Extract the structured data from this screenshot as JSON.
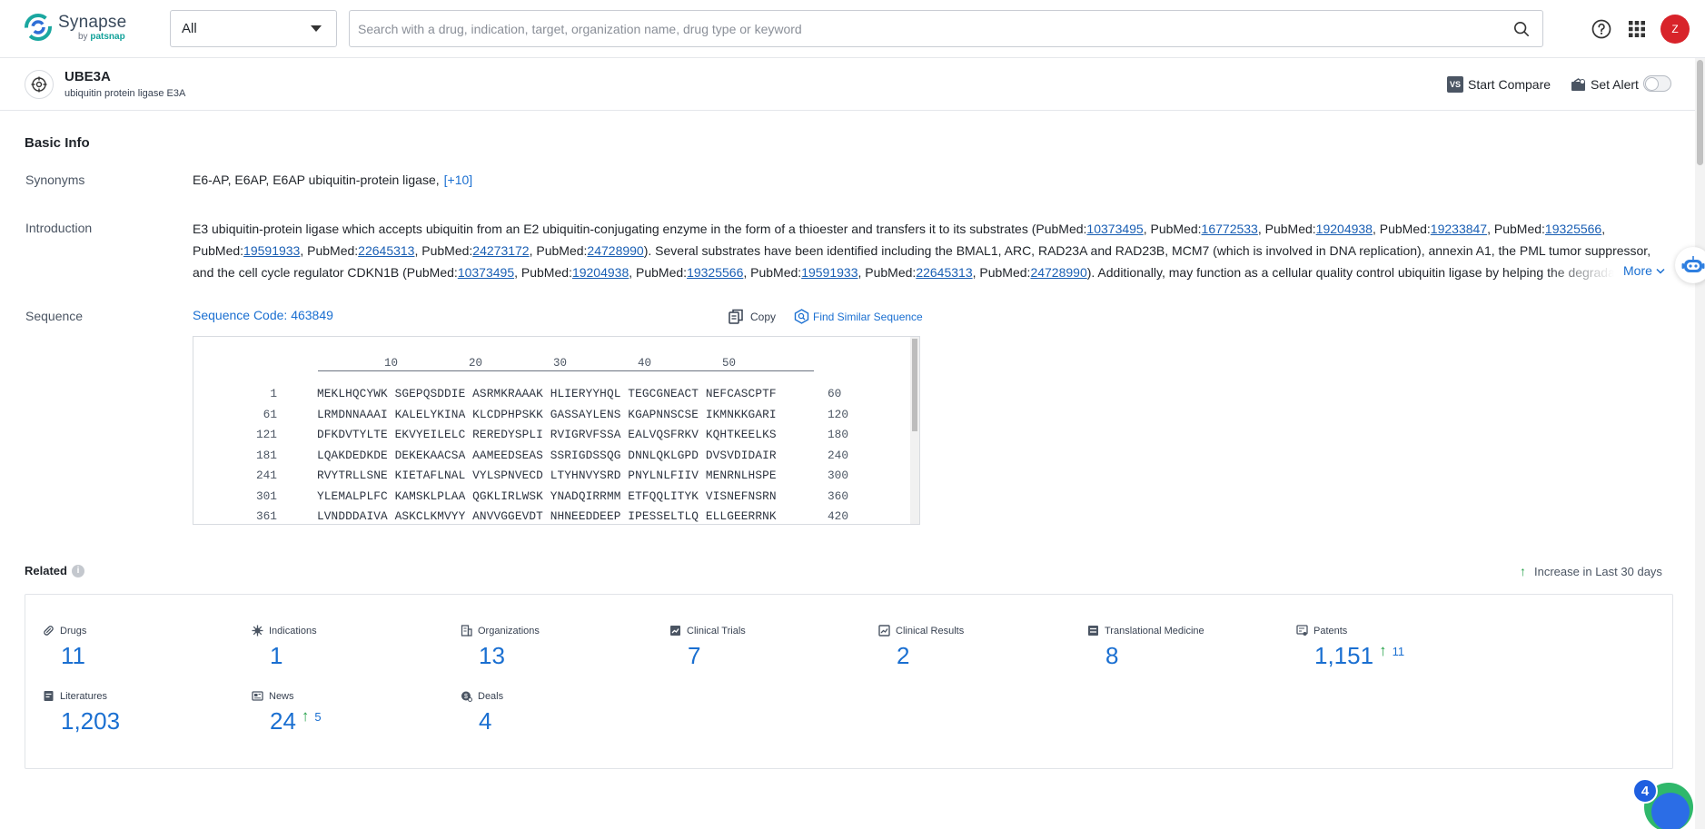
{
  "brand": {
    "name": "Synapse",
    "by": "by",
    "company": "patsnap"
  },
  "search": {
    "category": "All",
    "placeholder": "Search with a drug, indication, target, organization name, drug type or keyword"
  },
  "user": {
    "initial": "Z",
    "avatar_color": "#d8232a"
  },
  "entity": {
    "name": "UBE3A",
    "full_name": "ubiquitin protein ligase E3A",
    "compare_label": "Start Compare",
    "compare_badge": "VS",
    "alert_label": "Set Alert"
  },
  "basic_info": {
    "title": "Basic Info",
    "synonyms_label": "Synonyms",
    "synonyms_text": "E6-AP,  E6AP,  E6AP ubiquitin-protein ligase,",
    "synonyms_more": "[+10]",
    "introduction_label": "Introduction",
    "introduction_segments": [
      {
        "t": "E3 ubiquitin-protein ligase which accepts ubiquitin from an E2 ubiquitin-conjugating enzyme in the form of a thioester and transfers it to its substrates (PubMed:"
      },
      {
        "link": "10373495"
      },
      {
        "t": ", PubMed:"
      },
      {
        "link": "16772533"
      },
      {
        "t": ", PubMed:"
      },
      {
        "link": "19204938"
      },
      {
        "t": ", PubMed:"
      },
      {
        "link": "19233847"
      },
      {
        "t": ", PubMed:"
      },
      {
        "link": "19325566"
      },
      {
        "t": ", PubMed:"
      },
      {
        "link": "19591933"
      },
      {
        "t": ", PubMed:"
      },
      {
        "link": "22645313"
      },
      {
        "t": ", PubMed:"
      },
      {
        "link": "24273172"
      },
      {
        "t": ", PubMed:"
      },
      {
        "link": "24728990"
      },
      {
        "t": "). Several substrates have been identified including the BMAL1, ARC, RAD23A and RAD23B, MCM7 (which is involved in DNA replication), annexin A1, the PML tumor suppressor, and the cell cycle regulator CDKN1B (PubMed:"
      },
      {
        "link": "10373495"
      },
      {
        "t": ", PubMed:"
      },
      {
        "link": "19204938"
      },
      {
        "t": ", PubMed:"
      },
      {
        "link": "19325566"
      },
      {
        "t": ", PubMed:"
      },
      {
        "link": "19591933"
      },
      {
        "t": ", PubMed:"
      },
      {
        "link": "22645313"
      },
      {
        "t": ", PubMed:"
      },
      {
        "link": "24728990"
      },
      {
        "t": "). Additionally, may function as a cellular quality control ubiquitin ligase by helping the degradation of the cytoplasmic misfolded proteins."
      }
    ],
    "more_label": "More",
    "sequence_label": "Sequence",
    "sequence_code": "Sequence Code: 463849",
    "copy_label": "Copy",
    "find_similar_label": "Find Similar Sequence",
    "ruler": [
      "10",
      "20",
      "30",
      "40",
      "50"
    ],
    "sequence_rows": [
      {
        "start": "1",
        "residues": "MEKLHQCYWK SGEPQSDDIE ASRMKRAAAK HLIERYYHQL TEGCGNEACT NEFCASCPTF",
        "end": "60"
      },
      {
        "start": "61",
        "residues": "LRMDNNAAAI KALELYKINA KLCDPHPSKK GASSAYLENS KGAPNNSCSE IKMNKKGARI",
        "end": "120"
      },
      {
        "start": "121",
        "residues": "DFKDVTYLTE EKVYEILELC REREDYSPLI RVIGRVFSSA EALVQSFRKV KQHTKEELKS",
        "end": "180"
      },
      {
        "start": "181",
        "residues": "LQAKDEDKDE DEKEKAACSA AAMEEDSEAS SSRIGDSSQG DNNLQKLGPD DVSVDIDAIR",
        "end": "240"
      },
      {
        "start": "241",
        "residues": "RVYTRLLSNE KIETAFLNAL VYLSPNVECD LTYHNVYSRD PNYLNLFIIV MENRNLHSPE",
        "end": "300"
      },
      {
        "start": "301",
        "residues": "YLEMALPLFC KAMSKLPLAA QGKLIRLWSK YNADQIRRMM ETFQQLITYK VISNEFNSRN",
        "end": "360"
      },
      {
        "start": "361",
        "residues": "LVNDDDAIVA ASKCLKMVYY ANVVGGEVDT NHNEEDDEEP IPESSELTLQ ELLGEERRNK",
        "end": "420"
      }
    ]
  },
  "related": {
    "title": "Related",
    "info_icon": "i",
    "increase_legend": "Increase in Last 30 days",
    "increase_color": "#24a148",
    "stats": [
      {
        "label": "Drugs",
        "value": "11",
        "icon": "pill-icon"
      },
      {
        "label": "Indications",
        "value": "1",
        "icon": "virus-icon"
      },
      {
        "label": "Organizations",
        "value": "13",
        "icon": "building-icon"
      },
      {
        "label": "Clinical Trials",
        "value": "7",
        "icon": "clinical-trials-icon"
      },
      {
        "label": "Clinical Results",
        "value": "2",
        "icon": "clinical-results-icon"
      },
      {
        "label": "Translational Medicine",
        "value": "8",
        "icon": "translational-medicine-icon"
      },
      {
        "label": "Patents",
        "value": "1,151",
        "increase": "11",
        "icon": "patent-icon"
      },
      {
        "label": "Literatures",
        "value": "1,203",
        "icon": "literature-icon"
      },
      {
        "label": "News",
        "value": "24",
        "increase": "5",
        "icon": "news-icon"
      },
      {
        "label": "Deals",
        "value": "4",
        "icon": "deals-icon"
      }
    ]
  },
  "floating": {
    "badge_count": "4"
  }
}
